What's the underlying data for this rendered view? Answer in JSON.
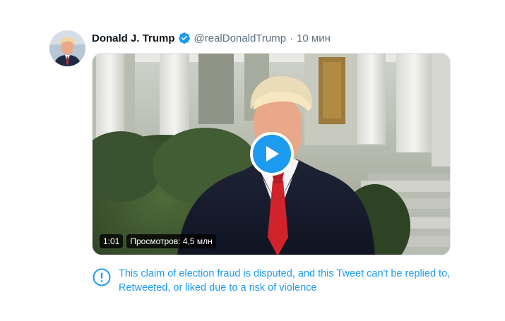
{
  "author": {
    "display_name": "Donald J. Trump",
    "handle": "@realDonaldTrump",
    "separator": "·",
    "time": "10 мин",
    "verified": true
  },
  "media": {
    "type": "video",
    "duration": "1:01",
    "views": "Просмотров: 4,5 млн"
  },
  "notice": {
    "text": "This claim of election fraud is disputed, and this Tweet can't be replied to, Retweeted, or liked due to a risk of violence",
    "icon": "exclamation-circle-icon"
  },
  "colors": {
    "accent": "#1d9bf0",
    "name_text": "#0f1419",
    "secondary_text": "#5b7083",
    "tie": "#d3232a"
  }
}
